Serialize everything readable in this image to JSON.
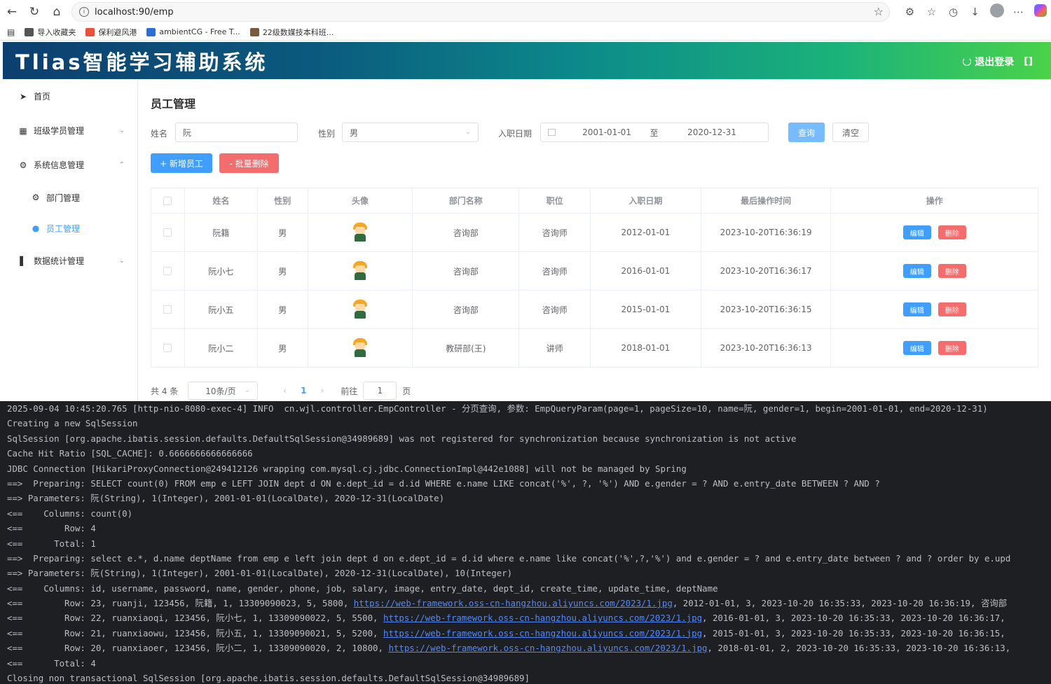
{
  "browser": {
    "url": "localhost:90/emp",
    "favorites": [
      {
        "label": "导入收藏夹",
        "color": "#555555"
      },
      {
        "label": "保利避风港",
        "color": "#e8513a"
      },
      {
        "label": "ambientCG - Free T...",
        "color": "#2a6fd6"
      },
      {
        "label": "22级数媒技本科班...",
        "color": "#7a5a3a"
      }
    ]
  },
  "app": {
    "title": "Tlias智能学习辅助系统",
    "logout_label": "退出登录"
  },
  "sidebar": {
    "items": [
      {
        "label": "首页",
        "icon": "send-icon"
      },
      {
        "label": "班级学员管理",
        "icon": "grid-icon"
      },
      {
        "label": "系统信息管理",
        "icon": "gear-icon"
      },
      {
        "label": "部门管理",
        "icon": "gear-icon"
      },
      {
        "label": "员工管理",
        "icon": "user-icon"
      },
      {
        "label": "数据统计管理",
        "icon": "bar-chart-icon"
      }
    ]
  },
  "page": {
    "title": "员工管理",
    "search": {
      "name_label": "姓名",
      "name_value": "阮",
      "gender_label": "性别",
      "gender_value": "男",
      "date_label": "入职日期",
      "date_start": "2001-01-01",
      "date_sep": "至",
      "date_end": "2020-12-31",
      "query_button": "查询",
      "clear_button": "清空"
    },
    "add_button": "+ 新增员工",
    "batch_delete_button": "- 批量删除",
    "table": {
      "columns": [
        "姓名",
        "性别",
        "头像",
        "部门名称",
        "职位",
        "入职日期",
        "最后操作时间",
        "操作"
      ],
      "rows": [
        {
          "name": "阮籍",
          "gender": "男",
          "dept": "咨询部",
          "job": "咨询师",
          "entry_date": "2012-01-01",
          "update_time": "2023-10-20T16:36:19"
        },
        {
          "name": "阮小七",
          "gender": "男",
          "dept": "咨询部",
          "job": "咨询师",
          "entry_date": "2016-01-01",
          "update_time": "2023-10-20T16:36:17"
        },
        {
          "name": "阮小五",
          "gender": "男",
          "dept": "咨询部",
          "job": "咨询师",
          "entry_date": "2015-01-01",
          "update_time": "2023-10-20T16:36:15"
        },
        {
          "name": "阮小二",
          "gender": "男",
          "dept": "教研部(王)",
          "job": "讲师",
          "entry_date": "2018-01-01",
          "update_time": "2023-10-20T16:36:13"
        }
      ],
      "edit_label": "编辑",
      "delete_label": "删除"
    },
    "pagination": {
      "total": "共 4 条",
      "page_size": "10条/页",
      "current_page": "1",
      "goto_label": "前往",
      "goto_value": "1",
      "page_suffix": "页"
    }
  },
  "console": {
    "lines": [
      "2025-09-04 10:45:20.765 [http-nio-8080-exec-4] INFO  cn.wjl.controller.EmpController - 分页查询, 参数: EmpQueryParam(page=1, pageSize=10, name=阮, gender=1, begin=2001-01-01, end=2020-12-31)",
      "Creating a new SqlSession",
      "SqlSession [org.apache.ibatis.session.defaults.DefaultSqlSession@34989689] was not registered for synchronization because synchronization is not active",
      "Cache Hit Ratio [SQL_CACHE]: 0.6666666666666666",
      "JDBC Connection [HikariProxyConnection@249412126 wrapping com.mysql.cj.jdbc.ConnectionImpl@442e1088] will not be managed by Spring",
      "==>  Preparing: SELECT count(0) FROM emp e LEFT JOIN dept d ON e.dept_id = d.id WHERE e.name LIKE concat('%', ?, '%') AND e.gender = ? AND e.entry_date BETWEEN ? AND ?",
      "==> Parameters: 阮(String), 1(Integer), 2001-01-01(LocalDate), 2020-12-31(LocalDate)",
      "<==    Columns: count(0)",
      "<==        Row: 4",
      "<==      Total: 1",
      "==>  Preparing: select e.*, d.name deptName from emp e left join dept d on e.dept_id = d.id where e.name like concat('%',?,'%') and e.gender = ? and e.entry_date between ? and ? order by e.upd",
      "==> Parameters: 阮(String), 1(Integer), 2001-01-01(LocalDate), 2020-12-31(LocalDate), 10(Integer)",
      "<==    Columns: id, username, password, name, gender, phone, job, salary, image, entry_date, dept_id, create_time, update_time, deptName"
    ],
    "row_lines": [
      {
        "prefix": "<==        Row: 23, ruanji, 123456, 阮籍, 1, 13309090023, 5, 5800, ",
        "url": "https://web-framework.oss-cn-hangzhou.aliyuncs.com/2023/1.jpg",
        "suffix": ", 2012-01-01, 3, 2023-10-20 16:35:33, 2023-10-20 16:36:19, 咨询部"
      },
      {
        "prefix": "<==        Row: 22, ruanxiaoqi, 123456, 阮小七, 1, 13309090022, 5, 5500, ",
        "url": "https://web-framework.oss-cn-hangzhou.aliyuncs.com/2023/1.jpg",
        "suffix": ", 2016-01-01, 3, 2023-10-20 16:35:33, 2023-10-20 16:36:17,"
      },
      {
        "prefix": "<==        Row: 21, ruanxiaowu, 123456, 阮小五, 1, 13309090021, 5, 5200, ",
        "url": "https://web-framework.oss-cn-hangzhou.aliyuncs.com/2023/1.jpg",
        "suffix": ", 2015-01-01, 3, 2023-10-20 16:35:33, 2023-10-20 16:36:15,"
      },
      {
        "prefix": "<==        Row: 20, ruanxiaoer, 123456, 阮小二, 1, 13309090020, 2, 10800, ",
        "url": "https://web-framework.oss-cn-hangzhou.aliyuncs.com/2023/1.jpg",
        "suffix": ", 2018-01-01, 2, 2023-10-20 16:35:33, 2023-10-20 16:36:13,"
      }
    ],
    "tail_lines": [
      "<==      Total: 4",
      "Closing non transactional SqlSession [org.apache.ibatis.session.defaults.DefaultSqlSession@34989689]"
    ]
  }
}
